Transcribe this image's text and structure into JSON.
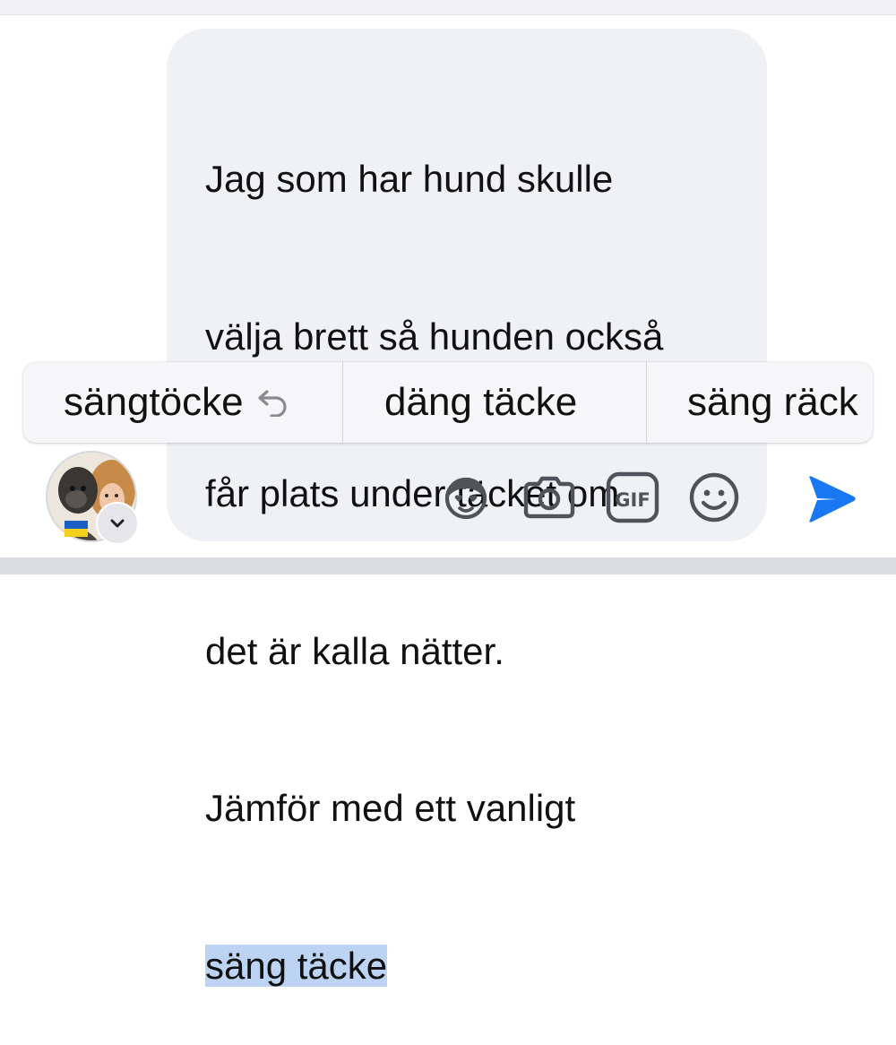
{
  "message": {
    "lines": [
      "Jag som har hund skulle",
      "välja brett så hunden också",
      "får plats under täcket om",
      "det är kalla nätter.",
      "Jämför med ett vanligt"
    ],
    "selected_text": "säng täcke"
  },
  "autocorrect": {
    "suggestions": [
      {
        "label": "sängtöcke",
        "icon": "undo-arrow-icon"
      },
      {
        "label": "däng täcke"
      },
      {
        "label": "säng räck"
      }
    ]
  },
  "composer": {
    "profile_flag": "ukraine-flag",
    "tools": [
      "avatar-sticker-icon",
      "camera-icon",
      "gif-icon",
      "emoji-icon"
    ],
    "send_icon": "send-icon"
  },
  "colors": {
    "selection": "#bcd3f3",
    "composer_bg": "#f0f1f5",
    "icon_gray": "#50535a",
    "send_blue": "#1877f2"
  }
}
